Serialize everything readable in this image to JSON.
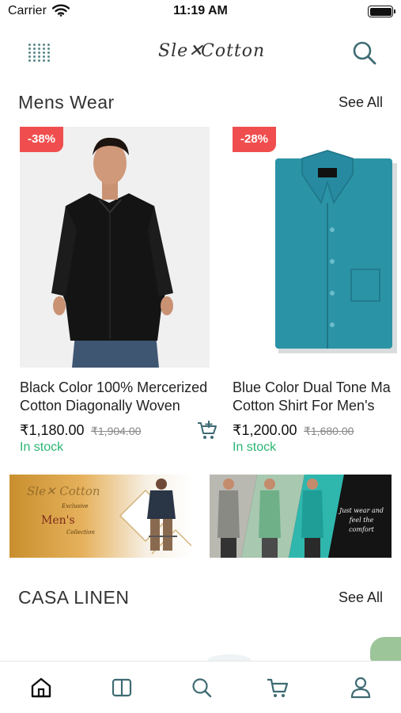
{
  "status_bar": {
    "carrier": "Carrier",
    "time": "11:19 AM"
  },
  "header": {
    "menu_icon": "dots-grid-icon",
    "logo_part1": "Sle✕",
    "logo_part2": "Cotton",
    "search_icon": "search-icon"
  },
  "mens_section": {
    "title": "Mens Wear",
    "see_all": "See All"
  },
  "products": [
    {
      "discount": "-38%",
      "title_line1": "Black Color 100% Mercerized",
      "title_line2": "Cotton Diagonally Woven",
      "price": "₹1,180.00",
      "old_price": "₹1,904.00",
      "stock": "In stock",
      "shirt_color": "#141414"
    },
    {
      "discount": "-28%",
      "title_line1": "Blue Color Dual Tone Ma",
      "title_line2": "Cotton Shirt For Men's",
      "price": "₹1,200.00",
      "old_price": "₹1,680.00",
      "stock": "In stock",
      "shirt_color": "#2b93a6"
    }
  ],
  "banners": {
    "left": {
      "brand": "Sle✕ Cotton",
      "subtitle": "Exclusive",
      "heading": "Men's",
      "caption": "Collection"
    },
    "right": {
      "quote_line1": "Just wear and",
      "quote_line2": "feel the comfort"
    }
  },
  "casa_section": {
    "title": "CASA LINEN",
    "see_all": "See All"
  },
  "bottom_nav": [
    "home-icon",
    "catalog-icon",
    "search-icon",
    "cart-icon",
    "profile-icon"
  ],
  "colors": {
    "discount_red": "#f04e4e",
    "in_stock_green": "#2bb673",
    "icon_teal": "#3e6b73"
  }
}
